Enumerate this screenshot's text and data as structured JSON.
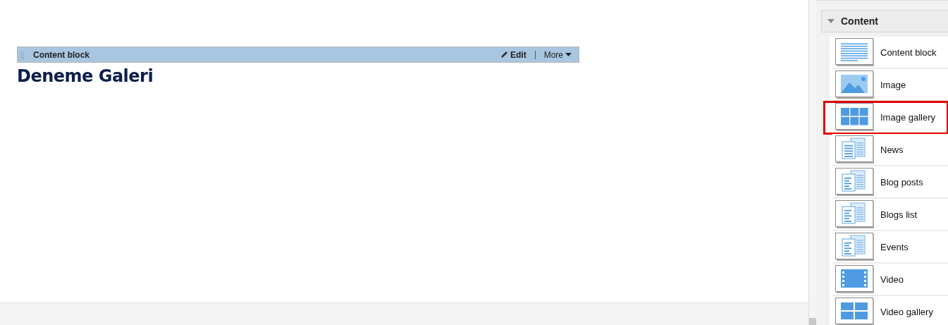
{
  "content_block": {
    "title": "Content block",
    "edit": "Edit",
    "more": "More",
    "heading": "Deneme Galeri"
  },
  "panel": {
    "section": {
      "title": "Content",
      "expanded": true
    },
    "items": [
      {
        "label": "Content block",
        "kind": "lines",
        "highlighted": false
      },
      {
        "label": "Image",
        "kind": "image",
        "highlighted": false
      },
      {
        "label": "Image gallery",
        "kind": "grid",
        "highlighted": true
      },
      {
        "label": "News",
        "kind": "list",
        "highlighted": false
      },
      {
        "label": "Blog posts",
        "kind": "docs",
        "highlighted": false
      },
      {
        "label": "Blogs list",
        "kind": "docs",
        "highlighted": false
      },
      {
        "label": "Events",
        "kind": "docs",
        "highlighted": false
      },
      {
        "label": "Video",
        "kind": "film",
        "highlighted": false
      },
      {
        "label": "Video gallery",
        "kind": "films",
        "highlighted": false
      }
    ]
  }
}
